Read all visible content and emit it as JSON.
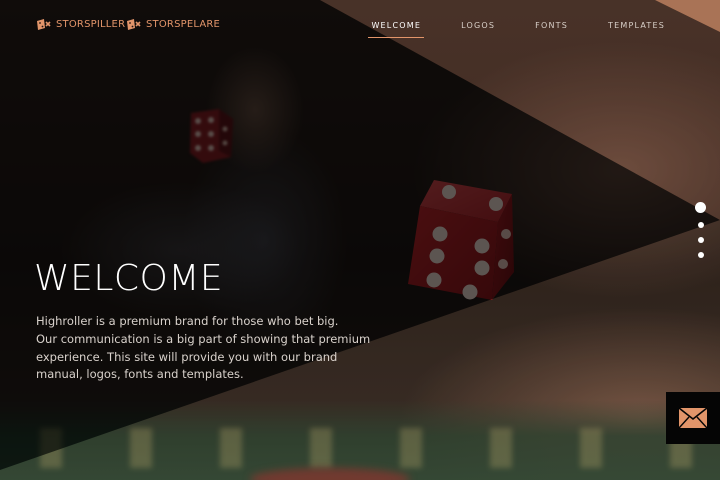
{
  "brands": [
    {
      "name": "STORSPILLER",
      "logo_icon": "dice-logo-icon"
    },
    {
      "name": "STORSPELARE",
      "logo_icon": "dice-logo-icon"
    }
  ],
  "nav": {
    "items": [
      {
        "label": "WELCOME",
        "active": true
      },
      {
        "label": "LOGOS",
        "active": false
      },
      {
        "label": "FONTS",
        "active": false
      },
      {
        "label": "TEMPLATES",
        "active": false
      }
    ]
  },
  "hero": {
    "title": "WELCOME",
    "lines": [
      "Highroller is a premium brand for those who bet big.",
      "Our communication is a big part of showing that premium",
      "experience. This site will provide you with our brand",
      "manual, logos, fonts and templates."
    ]
  },
  "slides": {
    "count": 4,
    "active_index": 0
  },
  "contact": {
    "icon": "envelope-icon"
  },
  "colors": {
    "accent": "#e2956a",
    "overlay_dark": "#000000",
    "overlay_copper": "#c98a66"
  }
}
